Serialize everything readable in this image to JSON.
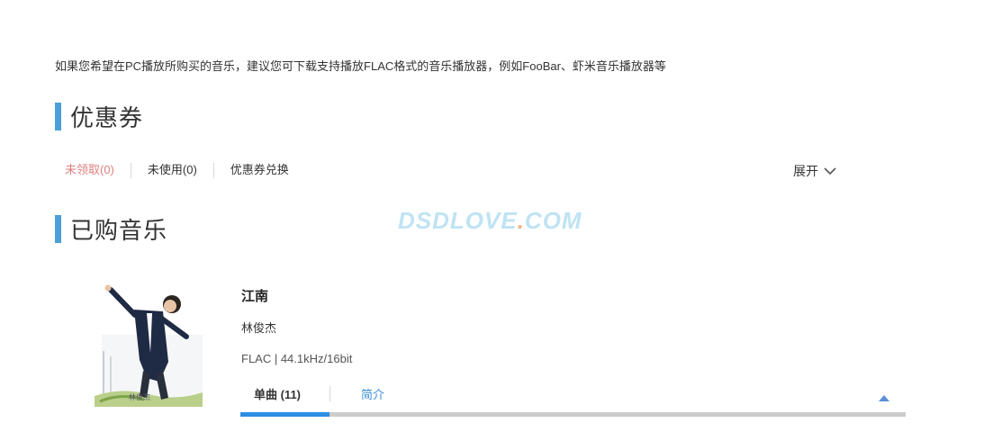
{
  "notice": "如果您希望在PC播放所购买的音乐，建议您可下载支持播放FLAC格式的音乐播放器，例如FooBar、虾米音乐播放器等",
  "coupons": {
    "title": "优惠券",
    "tabs": [
      {
        "label": "未领取(0)"
      },
      {
        "label": "未使用(0)"
      },
      {
        "label": "优惠券兑换"
      }
    ],
    "expand_label": "展开"
  },
  "purchased": {
    "title": "已购音乐",
    "album": {
      "title": "江南",
      "artist": "林俊杰",
      "format": "FLAC | 44.1kHz/16bit",
      "tabs": [
        {
          "label": "单曲 (11)",
          "active": true
        },
        {
          "label": "简介",
          "active": false
        }
      ],
      "progress": 0.134
    }
  },
  "watermark": {
    "text": "DSDLOVE",
    "dot": ".",
    "suffix": "COM"
  },
  "colors": {
    "accent_bar": "#4aa0d5",
    "unclaimed_tab": "#e07f7f",
    "link": "#3a8ed6",
    "progress_fill": "#2b8ee3",
    "progress_track": "#cccccc"
  }
}
